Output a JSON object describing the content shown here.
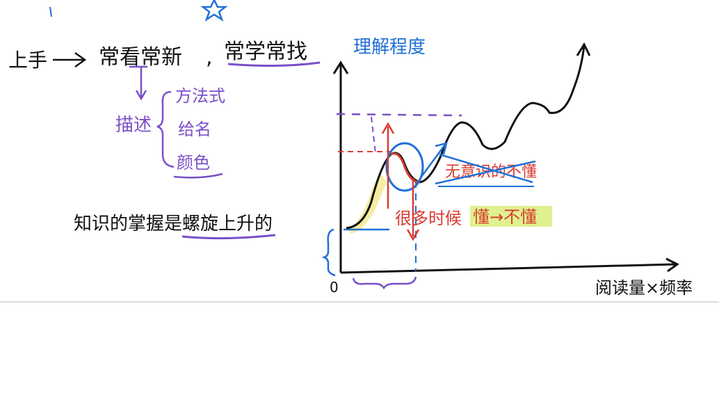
{
  "notes": {
    "start_label": "上手",
    "method_1": "常看常新",
    "method_2": "常学常找",
    "describe_label": "描述",
    "describe_items": [
      "方法式",
      "给名",
      "颜色"
    ],
    "spiral_statement": "知识的掌握是螺旋上升的"
  },
  "graph": {
    "y_axis_label": "理解程度",
    "x_axis_label": "阅读量×频率",
    "origin_label": "0",
    "crossed_note": "无意识的不懂",
    "reread_note": "很多时候",
    "highlight_note": "懂→不懂"
  },
  "colors": {
    "ink_black": "#111111",
    "purple": "#7a4fc9",
    "blue": "#1f6fd6",
    "red": "#d93b30",
    "highlight_yellow": "#f3e98a",
    "highlight_green": "#d9ef7c"
  },
  "icons": {
    "star": "star-icon"
  }
}
